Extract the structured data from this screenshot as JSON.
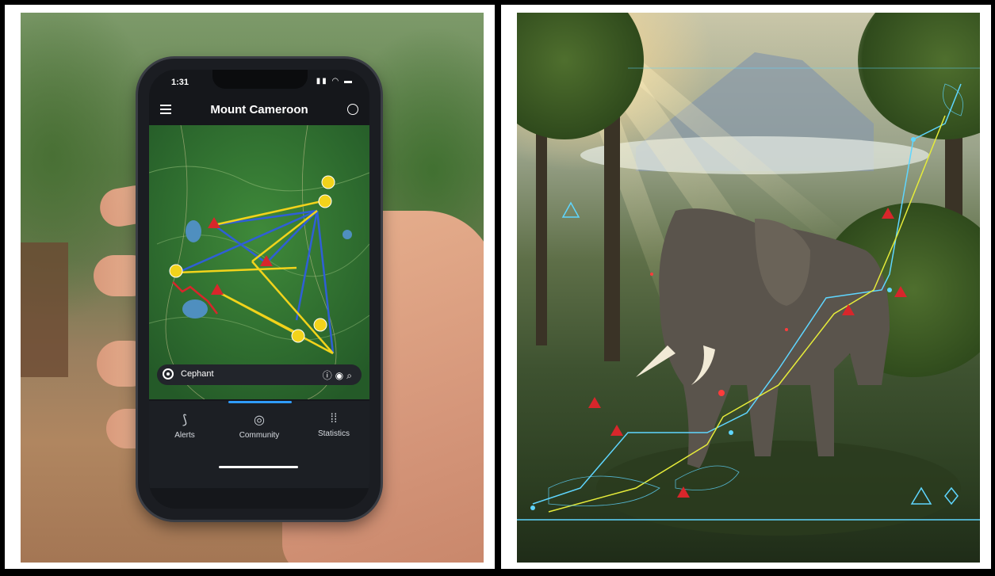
{
  "phone": {
    "status_time": "1:31",
    "app_title": "Mount Cameroon",
    "search": {
      "placeholder": "Cephant"
    },
    "tabs": [
      {
        "label": "Alerts",
        "icon": "route-icon"
      },
      {
        "label": "Community",
        "icon": "camera-icon"
      },
      {
        "label": "Statistics",
        "icon": "grid-icon"
      }
    ]
  },
  "colors": {
    "phone_body": "#1b1d22",
    "accent_blue": "#2f9cff",
    "route_blue": "#2f5fd6",
    "route_yellow": "#f2d31b",
    "route_red": "#d8262b",
    "hud_cyan": "#5fd6ff"
  }
}
